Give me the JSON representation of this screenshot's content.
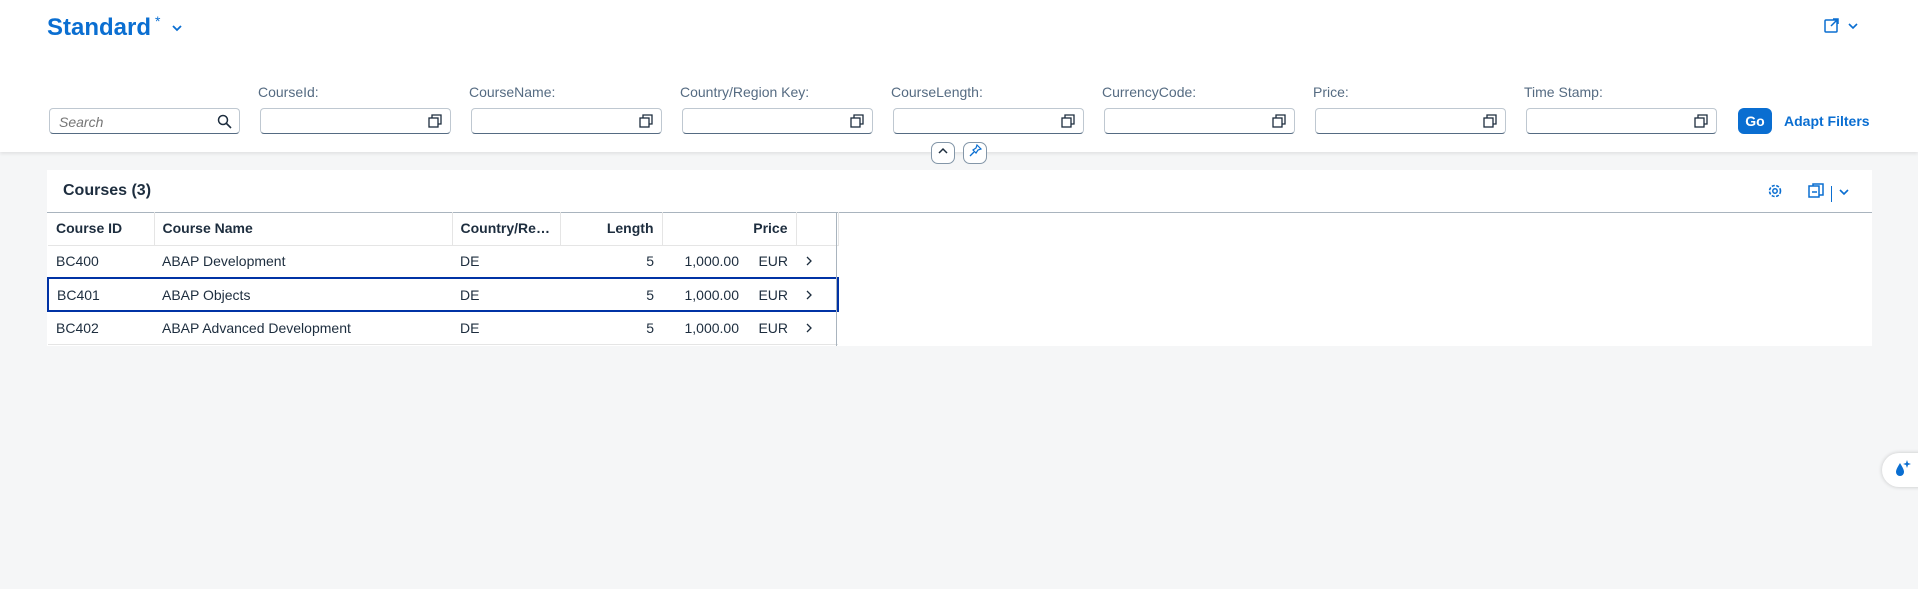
{
  "variant": {
    "title": "Standard",
    "modified_marker": "*"
  },
  "filters": {
    "search_placeholder": "Search",
    "fields": [
      {
        "label": "CourseId:",
        "value": ""
      },
      {
        "label": "CourseName:",
        "value": ""
      },
      {
        "label": "Country/Region Key:",
        "value": ""
      },
      {
        "label": "CourseLength:",
        "value": ""
      },
      {
        "label": "CurrencyCode:",
        "value": ""
      },
      {
        "label": "Price:",
        "value": ""
      },
      {
        "label": "Time Stamp:",
        "value": ""
      }
    ],
    "go_label": "Go",
    "adapt_label": "Adapt Filters"
  },
  "table": {
    "title": "Courses (3)",
    "columns": [
      "Course ID",
      "Course Name",
      "Country/Reg...",
      "Length",
      "Price"
    ],
    "rows": [
      {
        "id": "BC400",
        "name": "ABAP Development",
        "country": "DE",
        "length": "5",
        "price": "1,000.00",
        "currency": "EUR"
      },
      {
        "id": "BC401",
        "name": "ABAP Objects",
        "country": "DE",
        "length": "5",
        "price": "1,000.00",
        "currency": "EUR"
      },
      {
        "id": "BC402",
        "name": "ABAP Advanced Development",
        "country": "DE",
        "length": "5",
        "price": "1,000.00",
        "currency": "EUR"
      }
    ],
    "selected_row": 1
  },
  "colors": {
    "accent": "#0a6ed1",
    "selection": "#0032a5",
    "background": "#f5f6f7"
  },
  "icons": [
    "chevron-down-icon",
    "share-icon",
    "search-icon",
    "value-help-icon",
    "collapse-icon",
    "pin-icon",
    "settings-icon",
    "export-icon",
    "navigation-arrow-icon",
    "joule-icon"
  ]
}
